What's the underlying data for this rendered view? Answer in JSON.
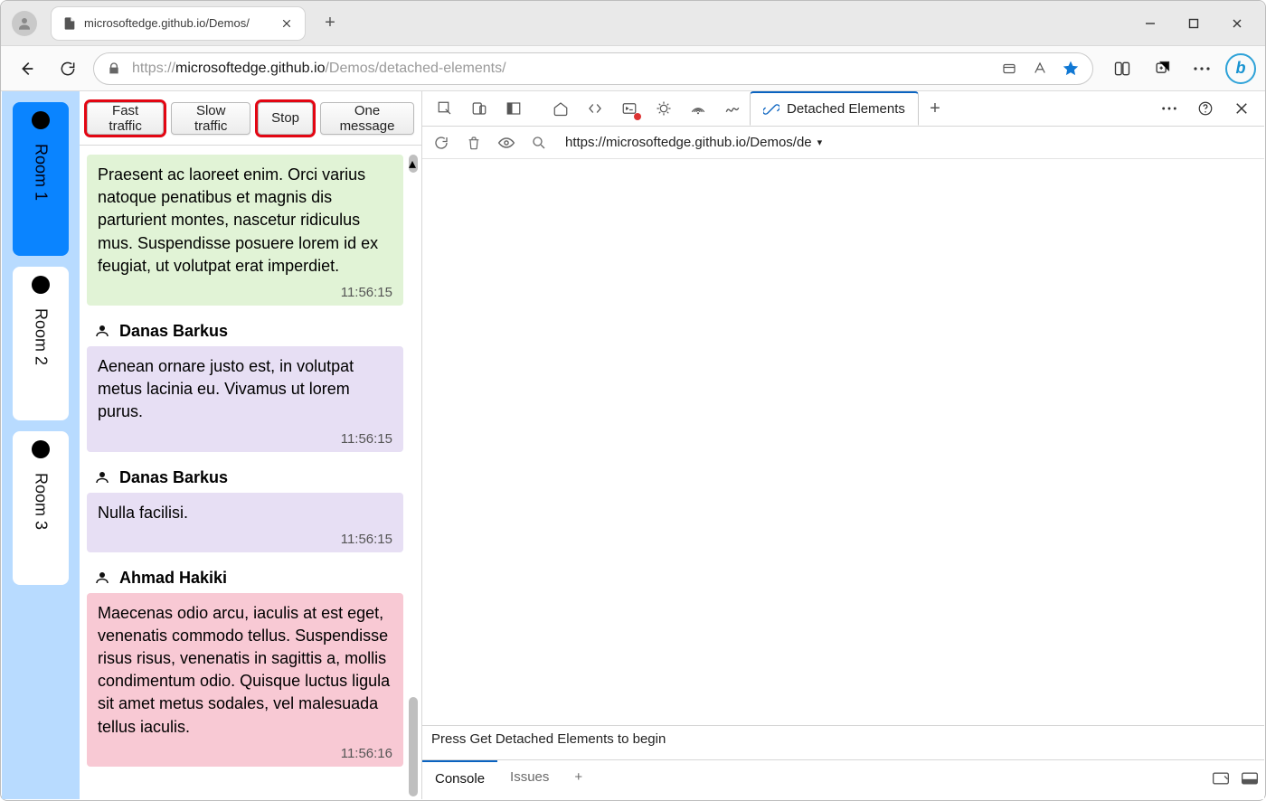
{
  "browser": {
    "tab_title": "microsoftedge.github.io/Demos/",
    "url_scheme": "https://",
    "url_host": "microsoftedge.github.io",
    "url_path": "/Demos/detached-elements/"
  },
  "rooms": [
    {
      "label": "Room 1",
      "active": true
    },
    {
      "label": "Room 2",
      "active": false
    },
    {
      "label": "Room 3",
      "active": false
    }
  ],
  "traffic_buttons": {
    "fast": "Fast traffic",
    "slow": "Slow traffic",
    "stop": "Stop",
    "one": "One message"
  },
  "messages": [
    {
      "show_header": false,
      "author": "",
      "text": "Praesent ac laoreet enim. Orci varius natoque penatibus et magnis dis parturient montes, nascetur ridiculus mus. Suspendisse posuere lorem id ex feugiat, ut volutpat erat imperdiet.",
      "time": "11:56:15",
      "color": "c-green"
    },
    {
      "show_header": true,
      "author": "Danas Barkus",
      "text": "Aenean ornare justo est, in volutpat metus lacinia eu. Vivamus ut lorem purus.",
      "time": "11:56:15",
      "color": "c-purple"
    },
    {
      "show_header": true,
      "author": "Danas Barkus",
      "text": "Nulla facilisi.",
      "time": "11:56:15",
      "color": "c-purple"
    },
    {
      "show_header": true,
      "author": "Ahmad Hakiki",
      "text": "Maecenas odio arcu, iaculis at est eget, venenatis commodo tellus. Suspendisse risus risus, venenatis in sagittis a, mollis condimentum odio. Quisque luctus ligula sit amet metus sodales, vel malesuada tellus iaculis.",
      "time": "11:56:16",
      "color": "c-pink"
    }
  ],
  "devtools": {
    "active_tab": "Detached Elements",
    "url_filter": "https://microsoftedge.github.io/Demos/de",
    "status": "Press Get Detached Elements to begin",
    "drawer_console": "Console",
    "drawer_issues": "Issues"
  }
}
